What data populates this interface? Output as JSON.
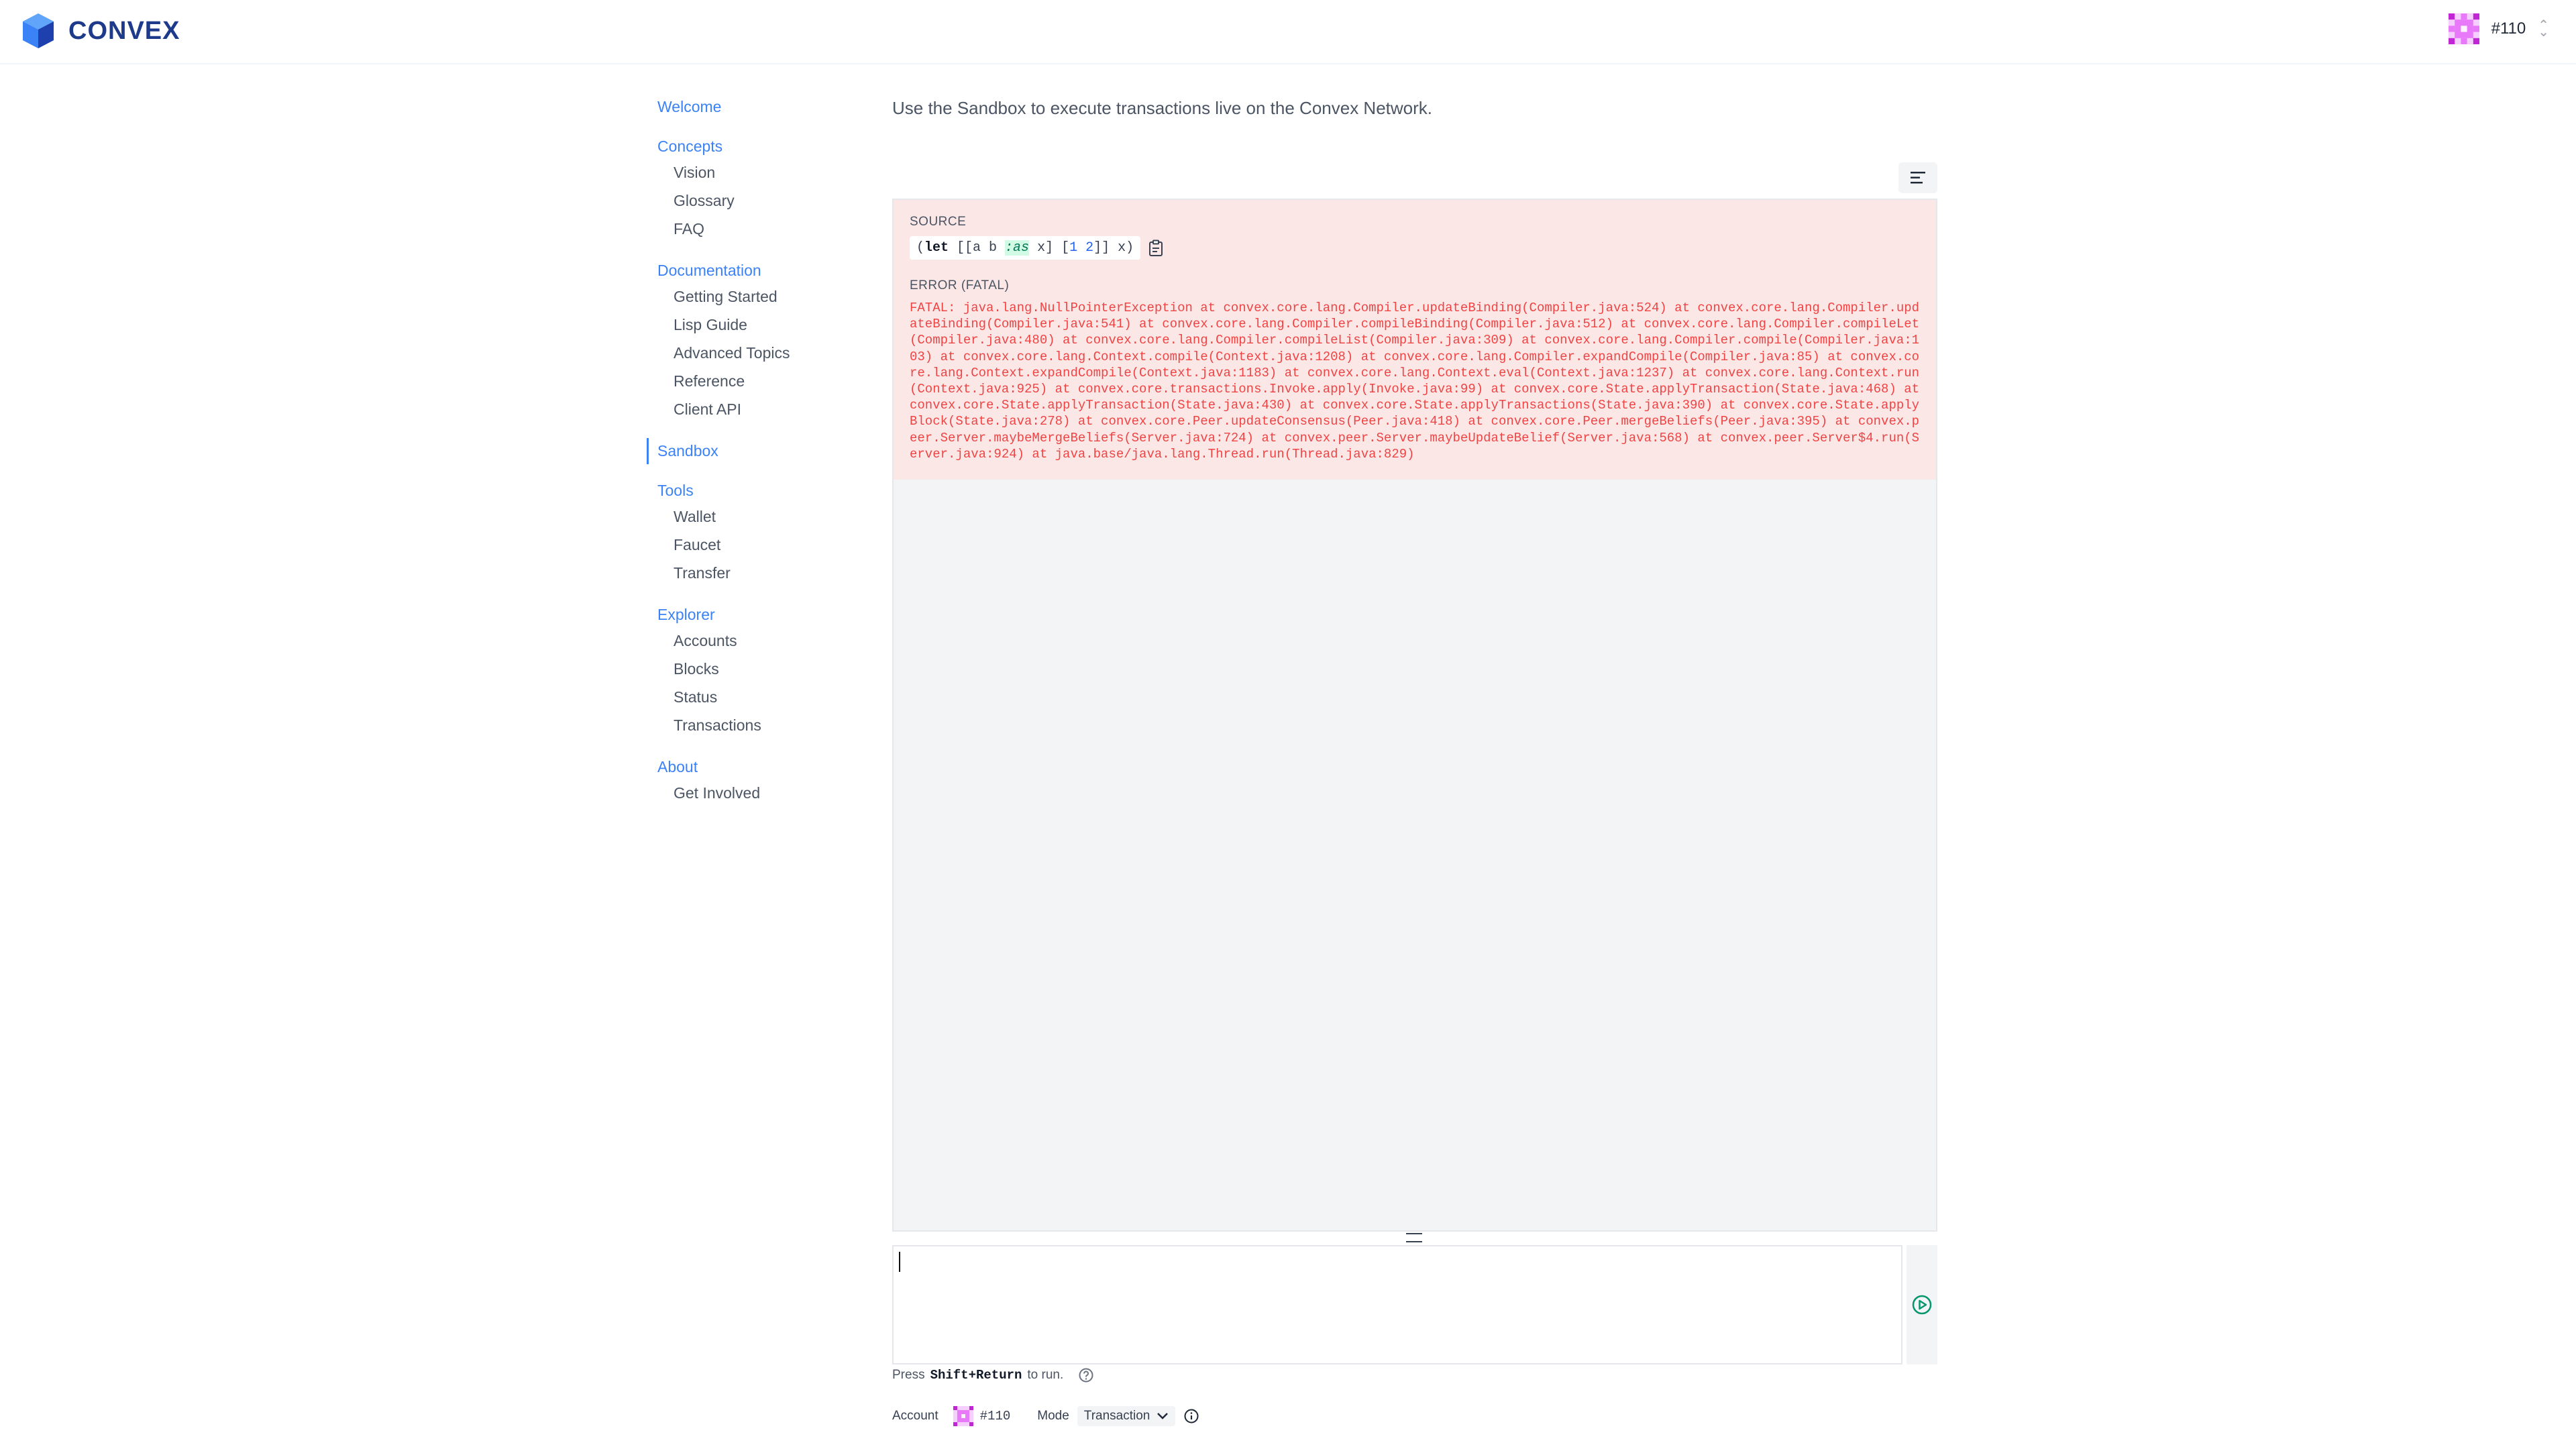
{
  "header": {
    "logo_text": "CONVEX",
    "account_number": "#110"
  },
  "sidebar": {
    "groups": [
      {
        "label": "Welcome",
        "items": []
      },
      {
        "label": "Concepts",
        "items": [
          "Vision",
          "Glossary",
          "FAQ"
        ]
      },
      {
        "label": "Documentation",
        "items": [
          "Getting Started",
          "Lisp Guide",
          "Advanced Topics",
          "Reference",
          "Client API"
        ]
      },
      {
        "label": "Sandbox",
        "items": [],
        "active": true
      },
      {
        "label": "Tools",
        "items": [
          "Wallet",
          "Faucet",
          "Transfer"
        ]
      },
      {
        "label": "Explorer",
        "items": [
          "Accounts",
          "Blocks",
          "Status",
          "Transactions"
        ]
      },
      {
        "label": "About",
        "items": [
          "Get Involved"
        ]
      }
    ]
  },
  "main": {
    "intro": "Use the Sandbox to execute transactions live on the Convex Network.",
    "source_label": "SOURCE",
    "source_code": {
      "open": "(",
      "kw": "let",
      "part1": " [[a b ",
      "keyword": ":as",
      "part2": " x] [",
      "nums": "1 2",
      "part3": "]] x)"
    },
    "error_label": "ERROR (FATAL)",
    "error_text": "FATAL: java.lang.NullPointerException at convex.core.lang.Compiler.updateBinding(Compiler.java:524) at convex.core.lang.Compiler.updateBinding(Compiler.java:541) at convex.core.lang.Compiler.compileBinding(Compiler.java:512) at convex.core.lang.Compiler.compileLet(Compiler.java:480) at convex.core.lang.Compiler.compileList(Compiler.java:309) at convex.core.lang.Compiler.compile(Compiler.java:103) at convex.core.lang.Context.compile(Context.java:1208) at convex.core.lang.Compiler.expandCompile(Compiler.java:85) at convex.core.lang.Context.expandCompile(Context.java:1183) at convex.core.lang.Context.eval(Context.java:1237) at convex.core.lang.Context.run(Context.java:925) at convex.core.transactions.Invoke.apply(Invoke.java:99) at convex.core.State.applyTransaction(State.java:468) at convex.core.State.applyTransaction(State.java:430) at convex.core.State.applyTransactions(State.java:390) at convex.core.State.applyBlock(State.java:278) at convex.core.Peer.updateConsensus(Peer.java:418) at convex.core.Peer.mergeBeliefs(Peer.java:395) at convex.peer.Server.maybeMergeBeliefs(Server.java:724) at convex.peer.Server.maybeUpdateBelief(Server.java:568) at convex.peer.Server$4.run(Server.java:924) at java.base/java.lang.Thread.run(Thread.java:829)",
    "hint_prefix": "Press",
    "hint_key": "Shift+Return",
    "hint_suffix": "to run.",
    "account_label": "Account",
    "account_value": "#110",
    "mode_label": "Mode",
    "mode_value": "Transaction"
  }
}
